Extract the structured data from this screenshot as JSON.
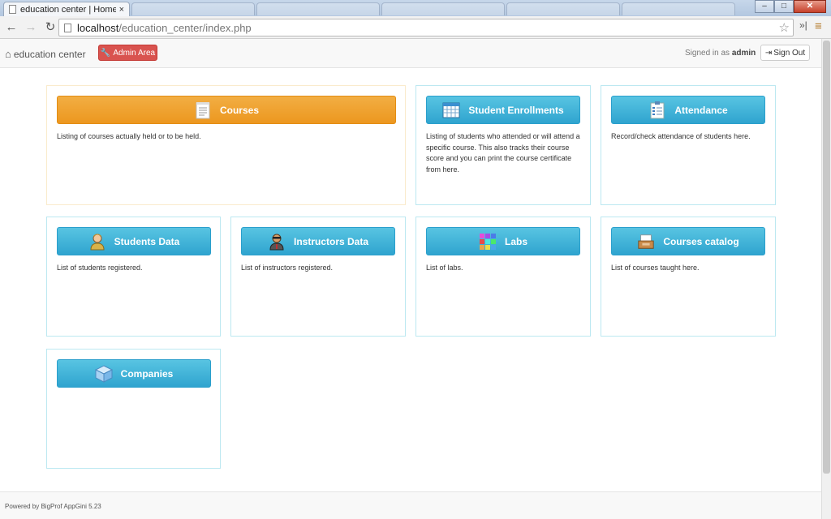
{
  "browser": {
    "active_tab_title": "education center | Homep",
    "tab_close": "×",
    "url_host": "localhost",
    "url_path": "/education_center/index.php"
  },
  "navbar": {
    "brand": "education center",
    "admin_label": "Admin Area",
    "signed_in_prefix": "Signed in as",
    "signed_in_user": "admin",
    "signout_label": "Sign Out"
  },
  "tiles": [
    {
      "title": "Courses",
      "description": "Listing of courses actually held or to be held.",
      "style": "warning",
      "icon": "notepad-icon"
    },
    {
      "title": "Student Enrollments",
      "description": "Listing of students who attended or will attend a specific course. This also tracks their course score and you can print the course certificate from here.",
      "style": "info",
      "icon": "calendar-grid-icon"
    },
    {
      "title": "Attendance",
      "description": "Record/check attendance of students here.",
      "style": "info",
      "icon": "checklist-icon"
    },
    {
      "title": "Students Data",
      "description": "List of students registered.",
      "style": "info",
      "icon": "student-icon"
    },
    {
      "title": "Instructors Data",
      "description": "List of instructors registered.",
      "style": "info",
      "icon": "instructor-icon"
    },
    {
      "title": "Labs",
      "description": "List of labs.",
      "style": "info",
      "icon": "color-grid-icon"
    },
    {
      "title": "Courses catalog",
      "description": "List of courses taught here.",
      "style": "info",
      "icon": "catalog-icon"
    },
    {
      "title": "Companies",
      "description": "",
      "style": "info",
      "icon": "cube-icon"
    }
  ],
  "footer": {
    "text": "Powered by BigProf AppGini 5.23"
  },
  "colors": {
    "info_button": "#39b3d7",
    "warning_button": "#f0ad4e",
    "danger_button": "#d9534f",
    "info_border": "#bce8f1",
    "warning_border": "#faebcc"
  }
}
